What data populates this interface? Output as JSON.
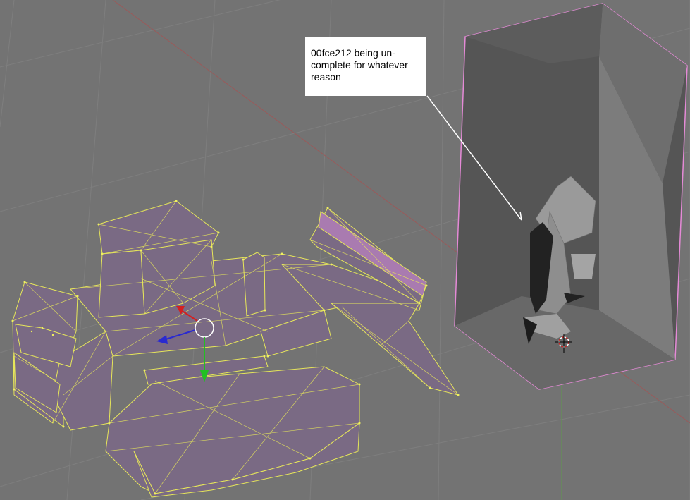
{
  "annotation": {
    "lines": [
      "00fce212 being un-",
      "complete for whatever",
      "reason"
    ]
  },
  "viewport": {
    "background": "#737373",
    "grid_color": "#7e7e7e",
    "x_axis_color": "#9a5a5a",
    "y_axis_color": "#5f9a4c"
  },
  "objects": {
    "tank_mesh": {
      "mode": "edit-wireframe",
      "face_color": "#7a6a84",
      "edge_color": "#e6e65a"
    },
    "selected_box": {
      "face_color": "#555555",
      "outline_color": "#e58ad7"
    }
  },
  "manipulator": {
    "x_axis_color": "#d42020",
    "y_axis_color": "#22c022",
    "z_axis_color": "#2a2ad0"
  }
}
